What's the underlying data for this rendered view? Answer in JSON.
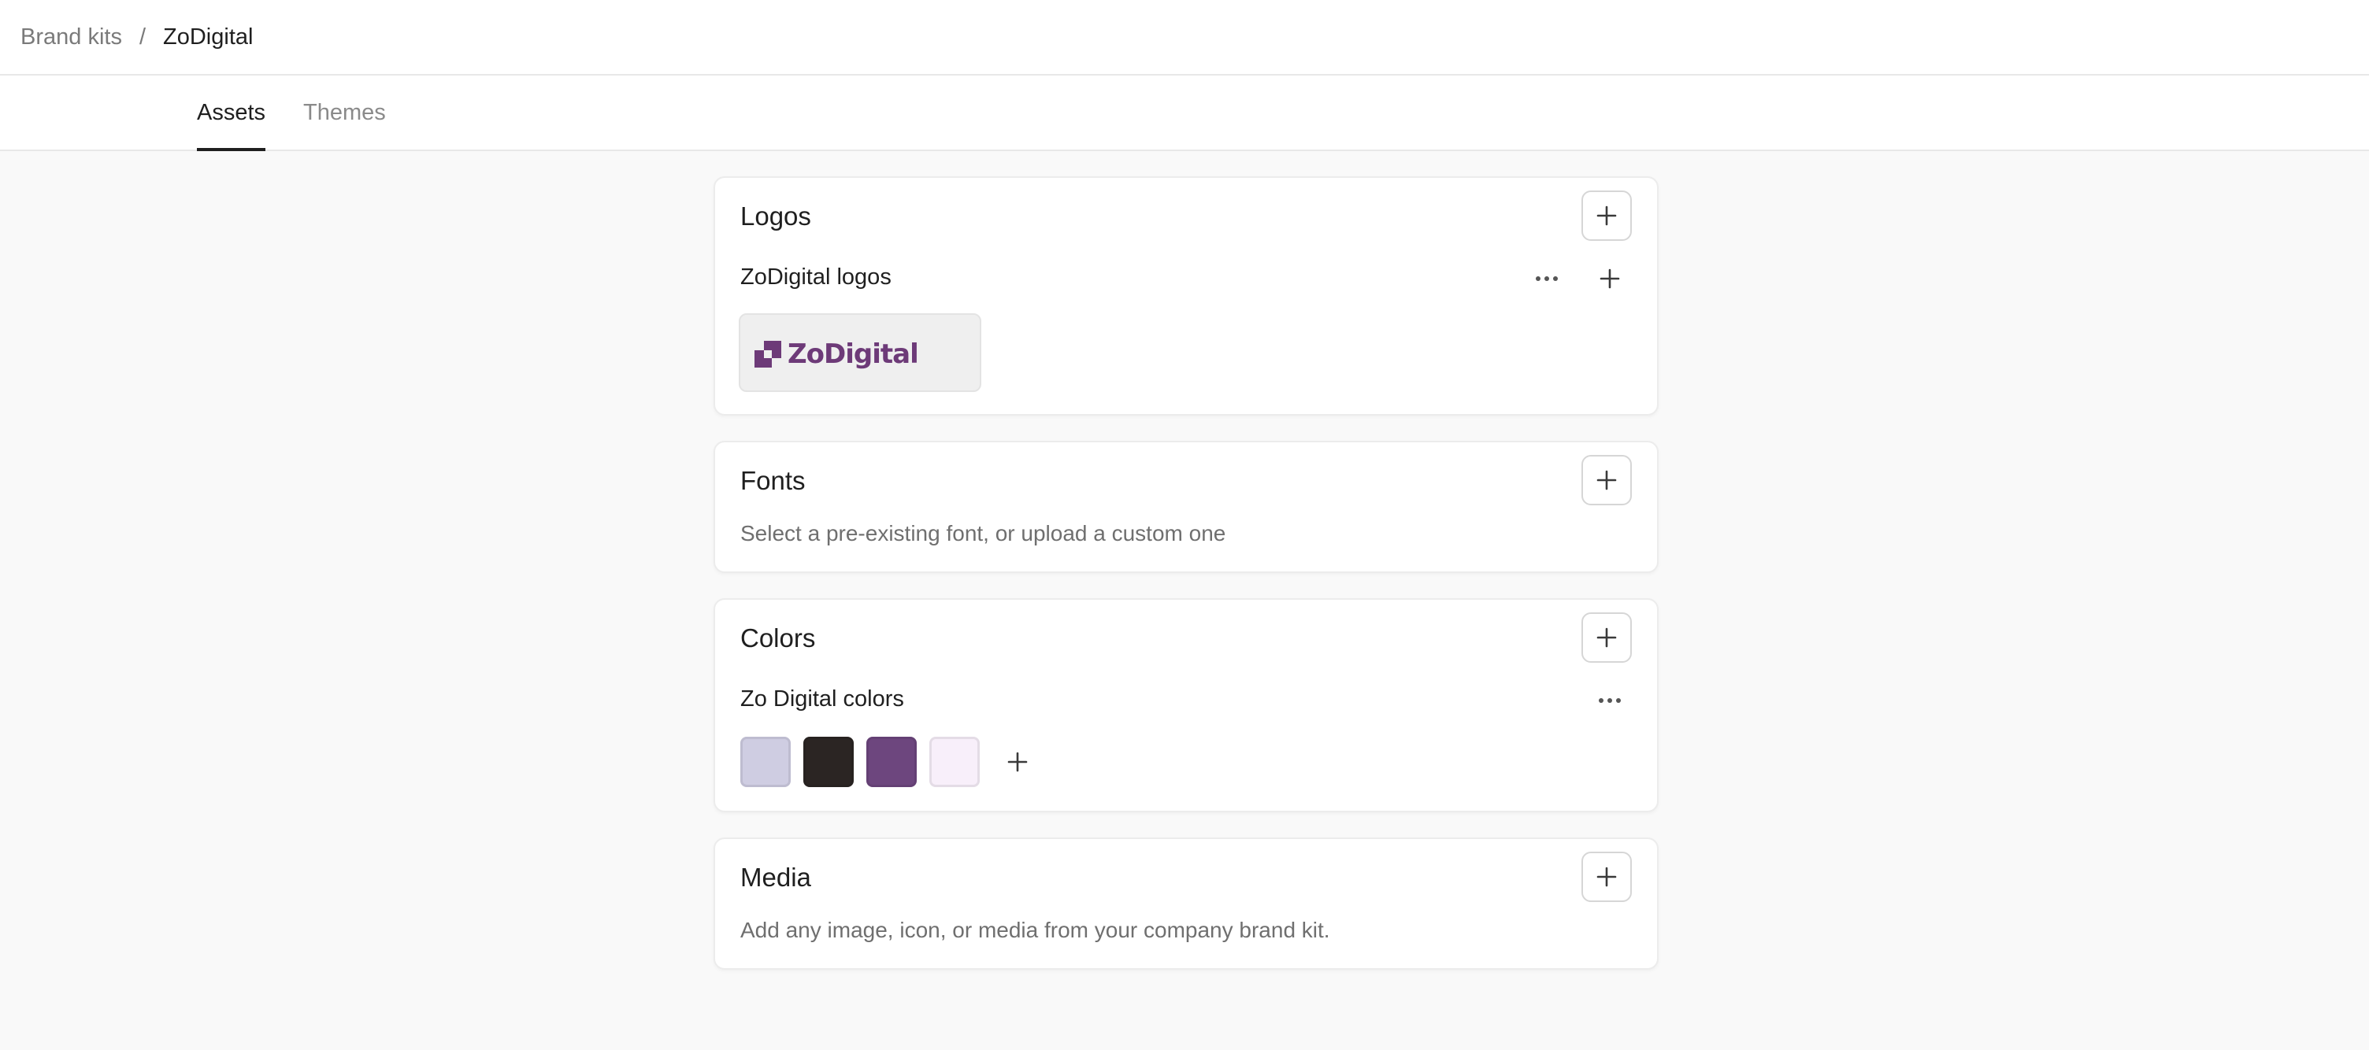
{
  "breadcrumb": {
    "parent": "Brand kits",
    "separator": "/",
    "current": "ZoDigital"
  },
  "tabs": [
    {
      "label": "Assets",
      "active": true
    },
    {
      "label": "Themes",
      "active": false
    }
  ],
  "logos": {
    "title": "Logos",
    "group_label": "ZoDigital logos",
    "logo_text": "ZoDigital",
    "logo_color": "#6d3a78"
  },
  "fonts": {
    "title": "Fonts",
    "description": "Select a pre-existing font, or upload a custom one"
  },
  "colors": {
    "title": "Colors",
    "group_label": "Zo Digital colors",
    "swatches": [
      "#cfcde2",
      "#2b2523",
      "#6d467e",
      "#f8effa"
    ]
  },
  "media": {
    "title": "Media",
    "description": "Add any image, icon, or media from your company brand kit."
  },
  "icons": {
    "add": "plus-icon",
    "more": "more-horizontal-icon"
  }
}
